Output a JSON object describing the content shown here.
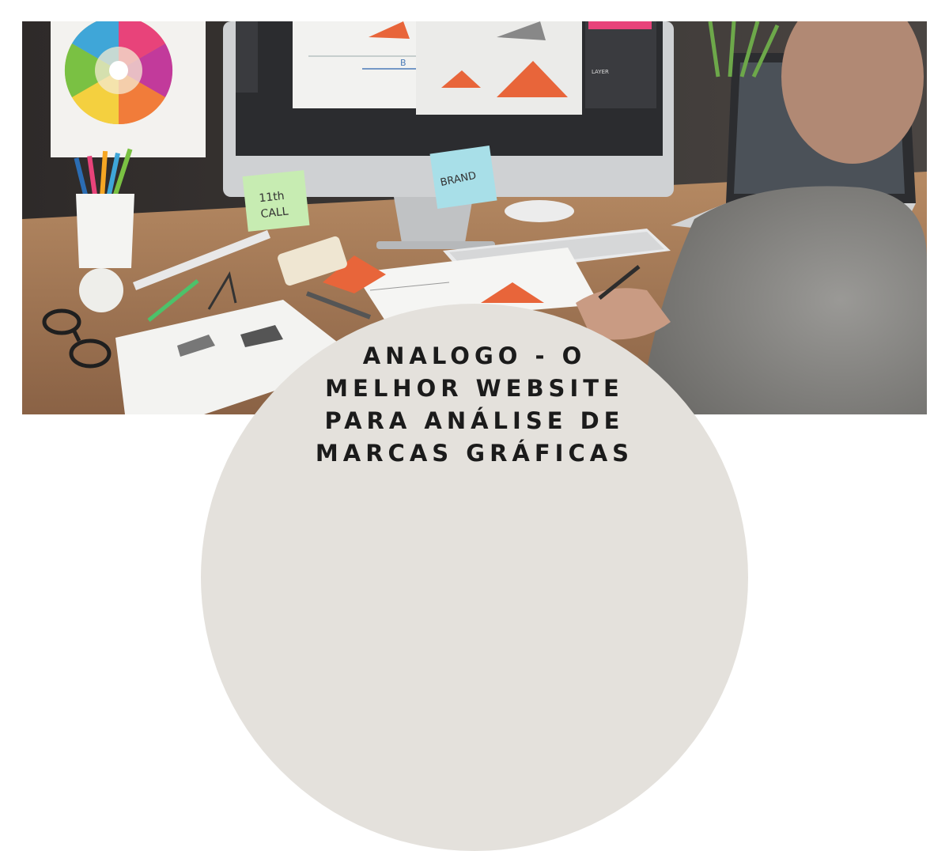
{
  "hero": {
    "alt": "Designer desk with monitor, laptop, color wheel and sketches",
    "sticky_notes": {
      "note_1_line1": "11th",
      "note_1_line2": "CALL",
      "note_2": "BRAND"
    },
    "monitor_panel_label": "LAYER",
    "chart_label_b": "B"
  },
  "headline": {
    "line1": "ANALOGO - O",
    "line2": "MELHOR WEBSITE",
    "line3": "PARA ANÁLISE DE",
    "line4": "MARCAS GRÁFICAS"
  },
  "colors": {
    "arch": "#e4e1dc",
    "text": "#1b1b1b",
    "accent_orange": "#e8653a"
  }
}
